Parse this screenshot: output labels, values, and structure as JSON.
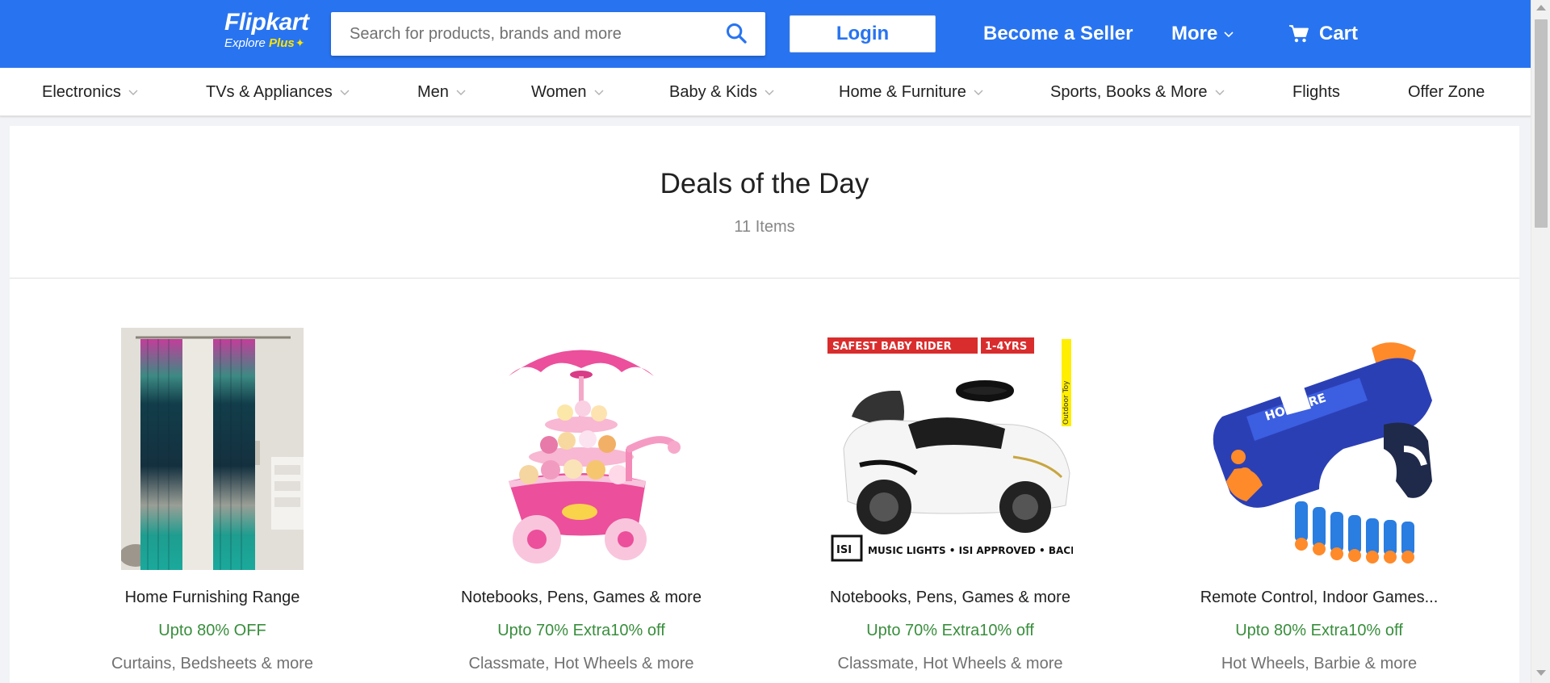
{
  "header": {
    "logo": {
      "brand": "Flipkart",
      "tagline": "Explore",
      "plus": "Plus"
    },
    "search": {
      "placeholder": "Search for products, brands and more"
    },
    "login_label": "Login",
    "seller_label": "Become a Seller",
    "more_label": "More",
    "cart_label": "Cart",
    "brand_color": "#2874f0"
  },
  "categories": [
    {
      "label": "Electronics",
      "dropdown": true
    },
    {
      "label": "TVs & Appliances",
      "dropdown": true
    },
    {
      "label": "Men",
      "dropdown": true
    },
    {
      "label": "Women",
      "dropdown": true
    },
    {
      "label": "Baby & Kids",
      "dropdown": true
    },
    {
      "label": "Home & Furniture",
      "dropdown": true
    },
    {
      "label": "Sports, Books & More",
      "dropdown": true
    },
    {
      "label": "Flights",
      "dropdown": false
    },
    {
      "label": "Offer Zone",
      "dropdown": false
    }
  ],
  "deals": {
    "title": "Deals of the Day",
    "count": "11 Items",
    "offer_color": "#388e3c",
    "items": [
      {
        "name": "Home Furnishing Range",
        "offer": "Upto 80% OFF",
        "brands": "Curtains, Bedsheets & more",
        "image": "curtains-image"
      },
      {
        "name": "Notebooks, Pens, Games & more",
        "offer": "Upto 70% Extra10% off",
        "brands": "Classmate, Hot Wheels & more",
        "image": "ice-cream-cart-toy-image"
      },
      {
        "name": "Notebooks, Pens, Games & more",
        "offer": "Upto 70% Extra10% off",
        "brands": "Classmate, Hot Wheels & more",
        "image": "baby-ride-on-car-image",
        "image_text": {
          "banner_left": "SAFEST BABY RIDER",
          "banner_right": "1-4YRS",
          "side": "Outdoor Toy",
          "mark": "ISI",
          "footer": "MUSIC LIGHTS • ISI APPROVED • BACKREST"
        }
      },
      {
        "name": "Remote Control, Indoor Games...",
        "offer": "Upto 80% Extra10% off",
        "brands": "Hot Wheels, Barbie & more",
        "image": "toy-blaster-image",
        "image_text": {
          "gun_label": "HOT FIRE"
        }
      }
    ]
  }
}
